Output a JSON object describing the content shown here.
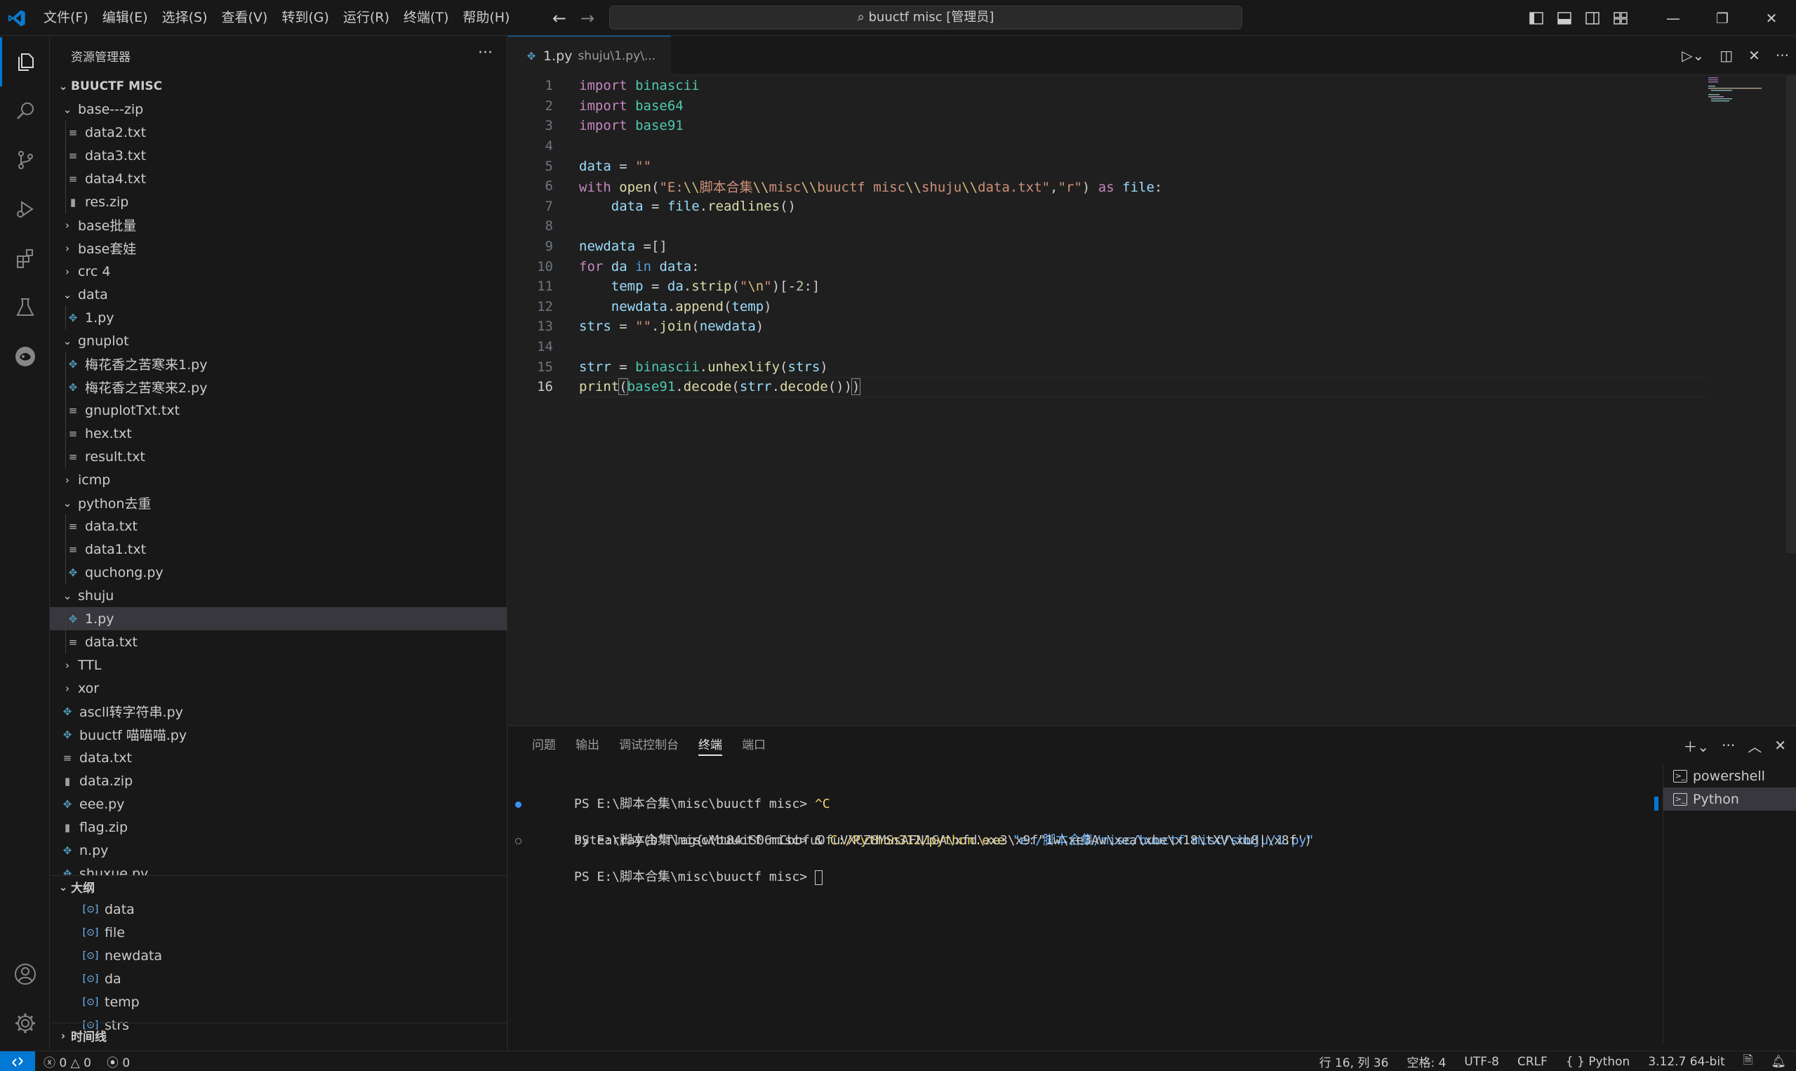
{
  "titlebar": {
    "menus": [
      "文件(F)",
      "编辑(E)",
      "选择(S)",
      "查看(V)",
      "转到(G)",
      "运行(R)",
      "终端(T)",
      "帮助(H)"
    ],
    "search_text": "buuctf misc [管理员]"
  },
  "sidebar": {
    "title": "资源管理器",
    "root": "BUUCTF MISC",
    "tree": [
      {
        "label": "base---zip",
        "type": "folder-open",
        "depth": 1
      },
      {
        "label": "data2.txt",
        "type": "txt",
        "depth": 2
      },
      {
        "label": "data3.txt",
        "type": "txt",
        "depth": 2
      },
      {
        "label": "data4.txt",
        "type": "txt",
        "depth": 2
      },
      {
        "label": "res.zip",
        "type": "zip",
        "depth": 2
      },
      {
        "label": "base批量",
        "type": "folder",
        "depth": 1
      },
      {
        "label": "base套娃",
        "type": "folder",
        "depth": 1
      },
      {
        "label": "crc 4",
        "type": "folder",
        "depth": 1
      },
      {
        "label": "data",
        "type": "folder-open",
        "depth": 1
      },
      {
        "label": "1.py",
        "type": "py",
        "depth": 2
      },
      {
        "label": "gnuplot",
        "type": "folder-open",
        "depth": 1
      },
      {
        "label": "梅花香之苦寒来1.py",
        "type": "py",
        "depth": 2
      },
      {
        "label": "梅花香之苦寒来2.py",
        "type": "py",
        "depth": 2
      },
      {
        "label": "gnuplotTxt.txt",
        "type": "txt",
        "depth": 2
      },
      {
        "label": "hex.txt",
        "type": "txt",
        "depth": 2
      },
      {
        "label": "result.txt",
        "type": "txt",
        "depth": 2
      },
      {
        "label": "icmp",
        "type": "folder",
        "depth": 1
      },
      {
        "label": "python去重",
        "type": "folder-open",
        "depth": 1
      },
      {
        "label": "data.txt",
        "type": "txt",
        "depth": 2
      },
      {
        "label": "data1.txt",
        "type": "txt",
        "depth": 2
      },
      {
        "label": "quchong.py",
        "type": "py",
        "depth": 2
      },
      {
        "label": "shuju",
        "type": "folder-open",
        "depth": 1
      },
      {
        "label": "1.py",
        "type": "py",
        "depth": 2,
        "selected": true
      },
      {
        "label": "data.txt",
        "type": "txt",
        "depth": 2
      },
      {
        "label": "TTL",
        "type": "folder",
        "depth": 1
      },
      {
        "label": "xor",
        "type": "folder",
        "depth": 1
      },
      {
        "label": "ascll转字符串.py",
        "type": "py",
        "depth": 1
      },
      {
        "label": "buuctf 喵喵喵.py",
        "type": "py",
        "depth": 1
      },
      {
        "label": "data.txt",
        "type": "txt",
        "depth": 1
      },
      {
        "label": "data.zip",
        "type": "zip",
        "depth": 1
      },
      {
        "label": "eee.py",
        "type": "py",
        "depth": 1
      },
      {
        "label": "flag.zip",
        "type": "zip",
        "depth": 1
      },
      {
        "label": "n.py",
        "type": "py",
        "depth": 1
      },
      {
        "label": "shuxue.py",
        "type": "py",
        "depth": 1
      }
    ],
    "outline_title": "大纲",
    "outline": [
      "data",
      "file",
      "newdata",
      "da",
      "temp",
      "strs"
    ],
    "timeline_title": "时间线"
  },
  "editor": {
    "tab_label": "1.py",
    "tab_path": "shuju\\1.py\\...",
    "current_line": 16
  },
  "panel": {
    "tabs": [
      "问题",
      "输出",
      "调试控制台",
      "终端",
      "端口"
    ],
    "active_tab": "终端",
    "terminal_lines": [
      {
        "prompt": "PS E:\\脚本合集\\misc\\buuctf misc> ",
        "cmd": "^C",
        "dot": "none"
      },
      {
        "prompt": "PS E:\\脚本合集\\misc\\buuctf misc> ",
        "amp": "& ",
        "exe": "C:/Python312/python.exe",
        "arg": " \"e:/脚本合集/misc/buuctf misc/shuju/1.py\"",
        "dot": "blue"
      },
      {
        "prompt": "",
        "cmd": "bytearray(b'flag{wMt84iS06mCbbfuOfuVXCZ8MSsAFN1GA\\xfd\\xe3\\x9f\"1w\\xe3Aw\\xea\\xbe\\x18\\tXV\\xb8|\\x8f')",
        "dot": "none"
      },
      {
        "prompt": "PS E:\\脚本合集\\misc\\buuctf misc> ",
        "cmd": "",
        "dot": "hollow",
        "cursor": true
      }
    ],
    "terminals": [
      "powershell",
      "Python"
    ],
    "active_terminal": "Python"
  },
  "statusbar": {
    "errors": "0",
    "warnings": "0",
    "ports": "0",
    "position": "行 16, 列 36",
    "spaces": "空格: 4",
    "encoding": "UTF-8",
    "eol": "CRLF",
    "language": "Python",
    "interpreter": "3.12.7 64-bit"
  },
  "colors": {
    "accent": "#0078d4",
    "background": "#1f1f1f",
    "sidebar": "#181818"
  }
}
